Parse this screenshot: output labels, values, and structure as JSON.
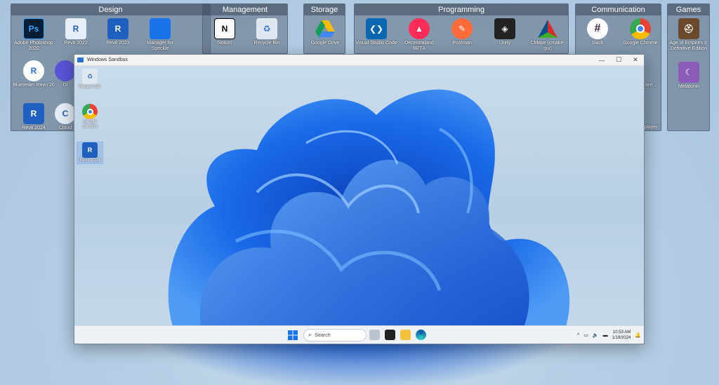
{
  "fences": [
    {
      "title": "Design",
      "icons": [
        "Adobe Photoshop 2020",
        "Revit 2022",
        "Revit 2023",
        "Manager for Speckle",
        "Bluebeam Revu 20",
        "Di",
        "Revit 2024",
        "Cloud"
      ]
    },
    {
      "title": "Management",
      "icons": [
        "Notion",
        "Recycle Bin"
      ]
    },
    {
      "title": "Storage",
      "icons": [
        "Google Drive"
      ]
    },
    {
      "title": "Programming",
      "icons": [
        "Visual Studio Code",
        "Decentraland BETA",
        "Postman",
        "Unity",
        "CMake (cmake-gui)"
      ]
    },
    {
      "title": "Communication",
      "icons": [
        "Slack",
        "Google Chrome",
        "are...",
        "player"
      ]
    },
    {
      "title": "Games",
      "icons": [
        "Age of Empires II: Definitive Edition",
        "Melatonin"
      ]
    }
  ],
  "sandbox": {
    "title": "Windows Sandbox",
    "controls": {
      "minimize": "—",
      "maximize": "☐",
      "close": "✕"
    },
    "desktop_icons": [
      "Recycle Bin",
      "Google Chrome",
      "Revit 2024"
    ],
    "taskbar": {
      "search_placeholder": "Search",
      "time": "10:53 AM",
      "date": "1/19/2024",
      "tray_chevron": "^"
    }
  },
  "colors": {
    "fence_bg": "#5c6e82",
    "wallpaper_blue": "#1559d0",
    "revit_blue": "#1f5fbf"
  }
}
